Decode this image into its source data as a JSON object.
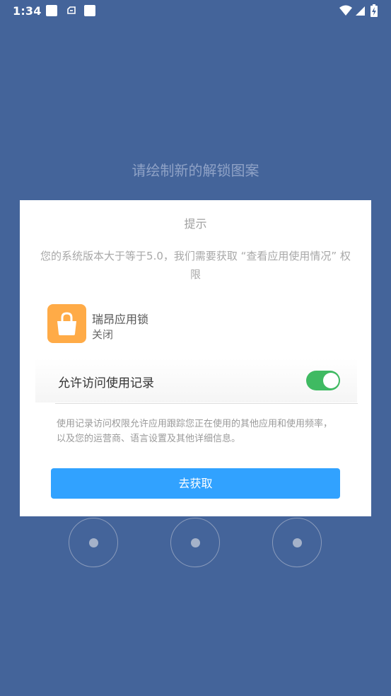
{
  "status_bar": {
    "time": "1:34",
    "notification_icons": [
      "square-notification-icon",
      "cloud-sync-icon",
      "square-notification-icon"
    ],
    "system_icons": [
      "wifi-icon",
      "cellular-signal-icon",
      "battery-charging-icon"
    ]
  },
  "pattern_screen": {
    "title": "请绘制新的解锁图案"
  },
  "dialog": {
    "title": "提示",
    "message": "您的系统版本大于等于5.0，我们需要获取 “查看应用使用情况” 权限",
    "app": {
      "icon": "lock-bag-icon",
      "name": "瑞昂应用锁",
      "state": "关闭"
    },
    "setting": {
      "label": "允许访问使用记录",
      "toggle_on": true,
      "description": "使用记录访问权限允许应用跟踪您正在使用的其他应用和使用频率，以及您的运营商、语言设置及其他详细信息。"
    },
    "button_label": "去获取"
  },
  "colors": {
    "background": "#44649a",
    "dialog_bg": "#ffffff",
    "app_icon": "#ffab47",
    "toggle_on": "#3fba62",
    "button": "#31a2ff"
  }
}
